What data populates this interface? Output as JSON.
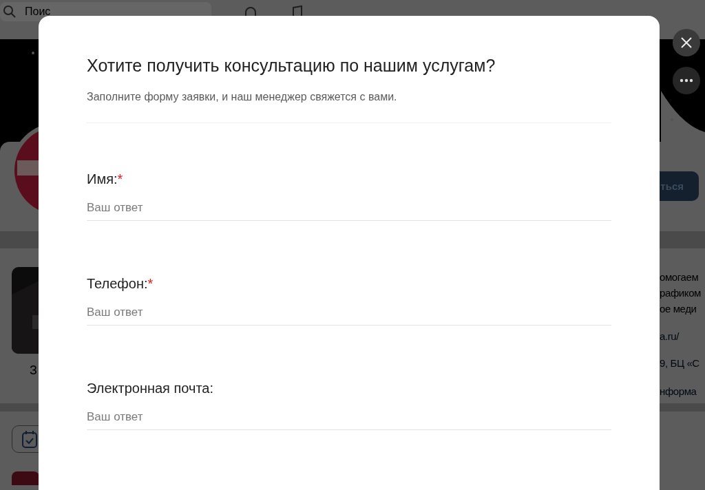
{
  "background": {
    "search": {
      "placeholder": "Поис"
    },
    "profile_button": "ться",
    "about_lines": [
      "омогаем",
      "рафиком",
      "ое меди"
    ],
    "link": "a.ru/",
    "address": "9, БЦ «С",
    "more_link": "нформа",
    "item_caption": "З"
  },
  "dialog": {
    "title": "Хотите получить консультацию по нашим услугам?",
    "subtitle": "Заполните форму заявки, и наш менеджер свяжется с вами.",
    "fields": [
      {
        "label": "Имя:",
        "required_mark": "*",
        "placeholder": "Ваш ответ"
      },
      {
        "label": "Телефон:",
        "required_mark": "*",
        "placeholder": "Ваш ответ"
      },
      {
        "label": "Электронная почта:",
        "placeholder": "Ваш ответ"
      }
    ]
  }
}
